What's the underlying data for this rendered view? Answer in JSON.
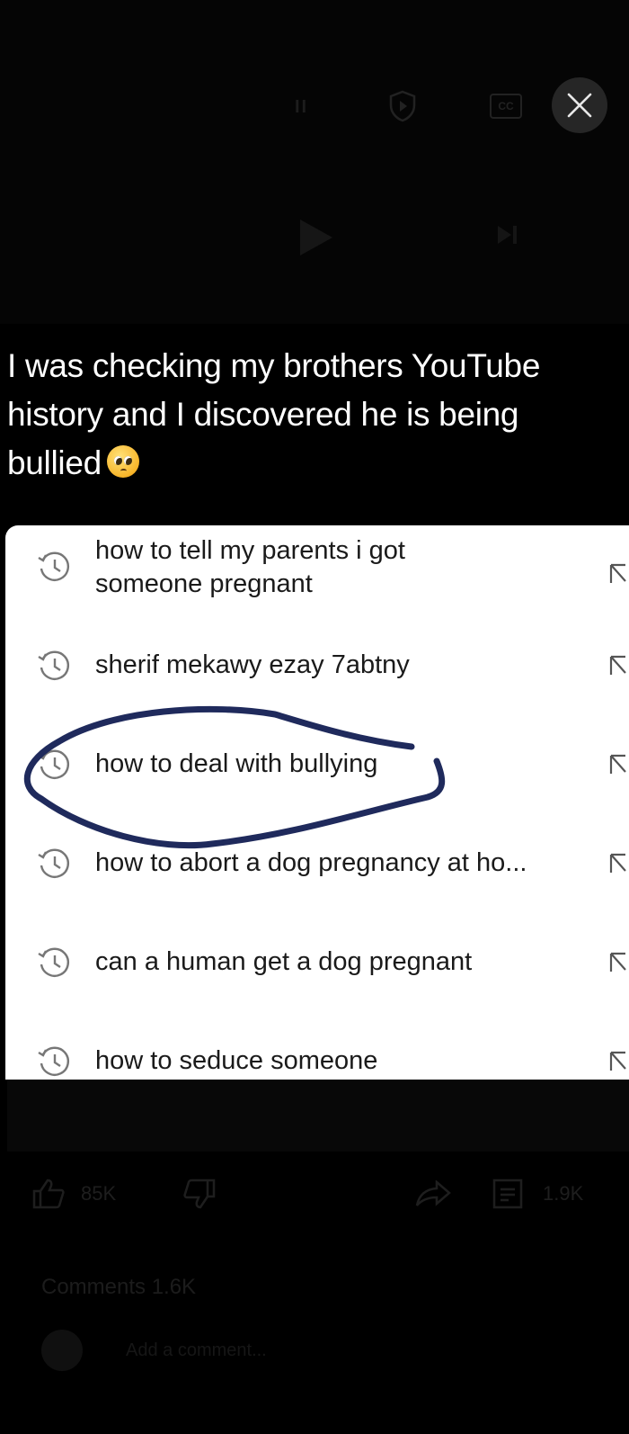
{
  "player": {
    "cc_label": "CC",
    "pause_glyph": "II"
  },
  "caption": {
    "text": "I was checking my brothers YouTube history and I discovered he is being bullied",
    "emoji_name": "pleading-face-emoji"
  },
  "history": {
    "items": [
      {
        "text": "how to tell my parents i got someone pregnant",
        "icon": "history-clock-icon"
      },
      {
        "text": "sherif mekawy ezay 7abtny",
        "icon": "history-clock-icon"
      },
      {
        "text": "how to deal with bullying",
        "icon": "history-clock-icon",
        "circled": true
      },
      {
        "text": "how to abort a dog pregnancy at ho...",
        "icon": "history-clock-icon"
      },
      {
        "text": "can a human get a dog pregnant",
        "icon": "history-clock-icon"
      },
      {
        "text": "how to seduce someone",
        "icon": "history-clock-icon"
      }
    ],
    "circle_color": "#1f2a5c"
  },
  "lower": {
    "like_count": "85K",
    "save_count": "1.9K",
    "comments_label": "Comments 1.6K",
    "add_comment_placeholder": "Add a comment..."
  }
}
